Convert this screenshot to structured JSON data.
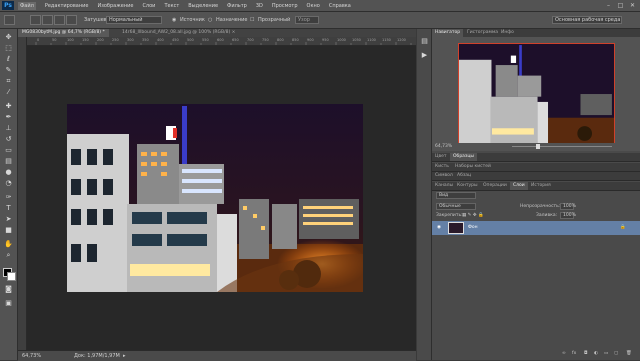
{
  "app": {
    "logo": "Ps"
  },
  "menu": {
    "items": [
      "Файл",
      "Редактирование",
      "Изображение",
      "Слои",
      "Текст",
      "Выделение",
      "Фильтр",
      "3D",
      "Просмотр",
      "Окно",
      "Справка"
    ]
  },
  "window_controls": {
    "minimize": "–",
    "maximize": "□",
    "close": "✕"
  },
  "options_bar": {
    "interpolation_label": "Затушевка:",
    "interpolation_value": "Нормальный",
    "source_label": "Источник",
    "destination_label": "Назначение",
    "transparent_label": "Прозрачный",
    "use_pattern_label": "Узор",
    "workspace_value": "Основная рабочая среда"
  },
  "document": {
    "tabs": [
      {
        "label": "MG0830bytM.jpg @ 64,7% (RGB/8) *",
        "active": true
      },
      {
        "label": "14r68_Illbound_AW2_08.all.jpg @ 100% (RGB/8) ×",
        "active": false
      }
    ],
    "ruler_ticks": [
      "0",
      "50",
      "100",
      "150",
      "200",
      "250",
      "300",
      "350",
      "400",
      "450",
      "500",
      "550",
      "600",
      "650",
      "700",
      "750",
      "800",
      "850",
      "900",
      "950",
      "1000",
      "1050",
      "1100",
      "1150",
      "1200"
    ],
    "zoom": "64,73%",
    "doc_size": "Док: 1,97М/1,97М"
  },
  "panels": {
    "top_tabs": [
      "Навигатор",
      "Гистограмма",
      "Инфо"
    ],
    "navigator_zoom": "64,73%",
    "color_tabs": [
      "Цвет",
      "Образцы"
    ],
    "style_tabs": [
      "Кисть",
      "Наборы кистей"
    ],
    "adjust_tabs": [
      "Символ",
      "Абзац"
    ],
    "layers_tabs": [
      "Каналы",
      "Контуры",
      "Операции",
      "Слои",
      "История"
    ],
    "layers_active": "Слои",
    "filter_kind": "Вид",
    "blend_mode": "Обычные",
    "opacity_label": "Непрозрачность:",
    "opacity_value": "100%",
    "lock_label": "Закрепить:",
    "fill_label": "Заливка:",
    "fill_value": "100%",
    "layer_name": "Фон"
  },
  "toolbar": {
    "tools": [
      "move-tool",
      "marquee-tool",
      "lasso-tool",
      "quick-select-tool",
      "crop-tool",
      "eyedropper-tool",
      "healing-tool",
      "brush-tool",
      "stamp-tool",
      "history-brush-tool",
      "eraser-tool",
      "gradient-tool",
      "blur-tool",
      "dodge-tool",
      "pen-tool",
      "type-tool",
      "path-select-tool",
      "shape-tool",
      "hand-tool",
      "zoom-tool"
    ]
  },
  "colors": {
    "accent": "#d0412b",
    "layer_selected": "#6480a6",
    "ps_blue": "#39a0f3"
  }
}
